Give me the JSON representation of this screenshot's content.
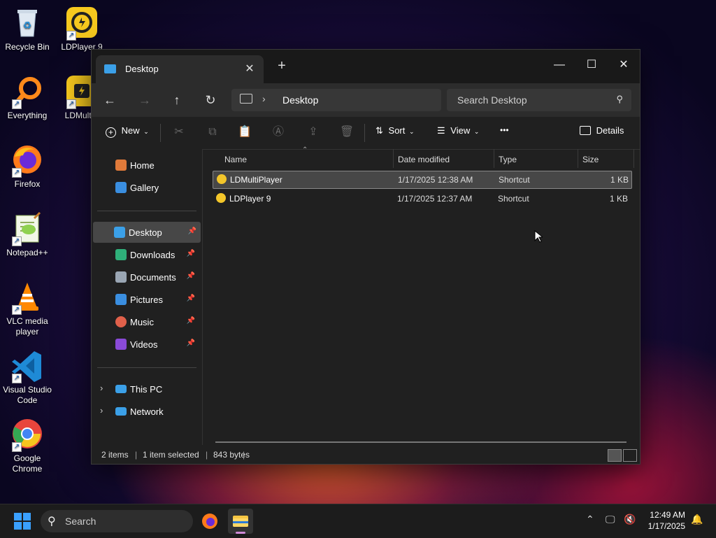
{
  "desktop": {
    "icons": [
      {
        "label": "Recycle Bin"
      },
      {
        "label": "LDPlayer 9"
      },
      {
        "label": "Everything"
      },
      {
        "label": "LDMultiP"
      },
      {
        "label": "Firefox"
      },
      {
        "label": "Notepad++"
      },
      {
        "label": "VLC media player"
      },
      {
        "label": "Visual Studio Code"
      },
      {
        "label": "Google Chrome"
      }
    ]
  },
  "window": {
    "tab_title": "Desktop",
    "tab_close": "✕",
    "new_tab": "+",
    "minimize": "—",
    "maximize": "☐",
    "close": "✕",
    "nav": {
      "back": "←",
      "forward": "→",
      "up": "↑",
      "refresh": "↻"
    },
    "breadcrumb": "Desktop",
    "breadcrumb_sep": "›",
    "search_placeholder": "Search Desktop",
    "toolbar": {
      "new_label": "New",
      "sort_label": "Sort",
      "view_label": "View",
      "more_label": "•••",
      "details_label": "Details"
    },
    "sidebar": {
      "items": [
        {
          "label": "Home"
        },
        {
          "label": "Gallery"
        },
        {
          "label": "Desktop",
          "selected": true
        },
        {
          "label": "Downloads"
        },
        {
          "label": "Documents"
        },
        {
          "label": "Pictures"
        },
        {
          "label": "Music"
        },
        {
          "label": "Videos"
        },
        {
          "label": "This PC"
        },
        {
          "label": "Network"
        }
      ]
    },
    "columns": [
      "Name",
      "Date modified",
      "Type",
      "Size"
    ],
    "files": [
      {
        "name": "LDMultiPlayer",
        "date": "1/17/2025 12:38 AM",
        "type": "Shortcut",
        "size": "1 KB",
        "selected": true
      },
      {
        "name": "LDPlayer 9",
        "date": "1/17/2025 12:37 AM",
        "type": "Shortcut",
        "size": "1 KB",
        "selected": false
      }
    ],
    "status": {
      "items": "2 items",
      "selected": "1 item selected",
      "bytes": "843 bytes"
    }
  },
  "taskbar": {
    "search_placeholder": "Search",
    "time": "12:49 AM",
    "date": "1/17/2025"
  },
  "colors": {
    "accent": "#3aa0ff",
    "selection": "#474747",
    "window_bg": "#202020"
  }
}
